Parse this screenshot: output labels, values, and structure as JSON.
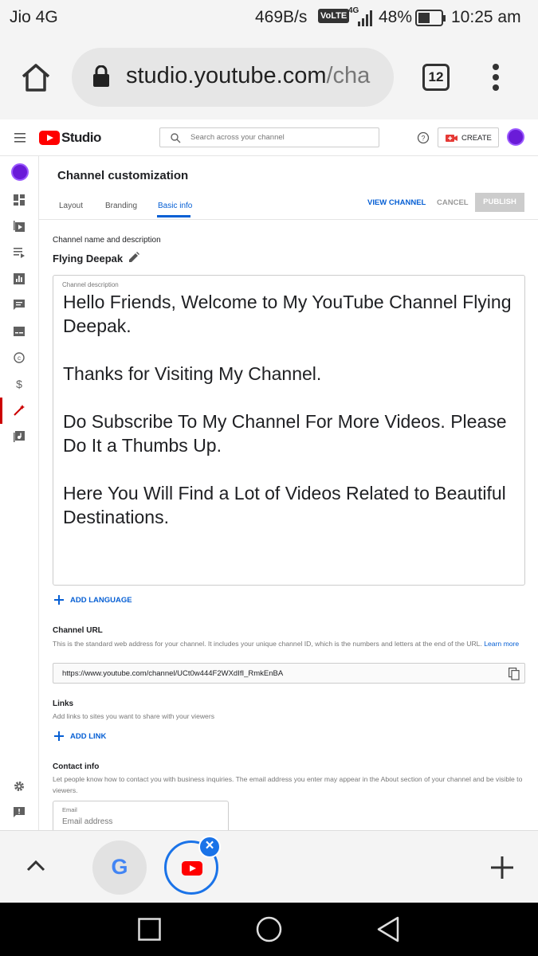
{
  "status_bar": {
    "carrier": "Jio 4G",
    "net_speed": "469B/s",
    "volte": "VoLTE",
    "network_type": "4G",
    "battery": "48%",
    "time": "10:25 am"
  },
  "browser": {
    "url_host": "studio.youtube.com",
    "url_rest": "/cha",
    "tab_count": "12"
  },
  "studio_header": {
    "brand": "Studio",
    "search_placeholder": "Search across your channel",
    "create_label": "CREATE"
  },
  "page": {
    "title": "Channel customization",
    "tabs": [
      {
        "label": "Layout",
        "active": false
      },
      {
        "label": "Branding",
        "active": false
      },
      {
        "label": "Basic info",
        "active": true
      }
    ],
    "view_channel": "VIEW CHANNEL",
    "cancel": "CANCEL",
    "publish": "PUBLISH"
  },
  "basic_info": {
    "section_heading": "Channel name and description",
    "channel_name": "Flying Deepak",
    "description_label": "Channel description",
    "description": "Hello Friends, Welcome to My YouTube Channel Flying Deepak.\n\nThanks for Visiting My Channel.\n\nDo Subscribe To My Channel For More Videos. Please Do It a Thumbs Up.\n\nHere You Will Find a Lot of Videos Related to Beautiful Destinations.",
    "add_language": "ADD LANGUAGE"
  },
  "channel_url": {
    "heading": "Channel URL",
    "help": "This is the standard web address for your channel. It includes your unique channel ID, which is the numbers and letters at the end of the URL.",
    "learn_more": "Learn more",
    "value": "https://www.youtube.com/channel/UCt0w444F2WXdIfI_RmkEnBA"
  },
  "links": {
    "heading": "Links",
    "help": "Add links to sites you want to share with your viewers",
    "add_link": "ADD LINK"
  },
  "contact": {
    "heading": "Contact info",
    "help": "Let people know how to contact you with business inquiries. The email address you enter may appear in the About section of your channel and be visible to viewers.",
    "email_label": "Email",
    "email_placeholder": "Email address"
  },
  "bottom_bar": {
    "google_letter": "G",
    "close_symbol": "×"
  },
  "colors": {
    "accent_blue": "#065fd4",
    "youtube_red": "#ff0000",
    "avatar_purple": "#6a1bd8"
  }
}
